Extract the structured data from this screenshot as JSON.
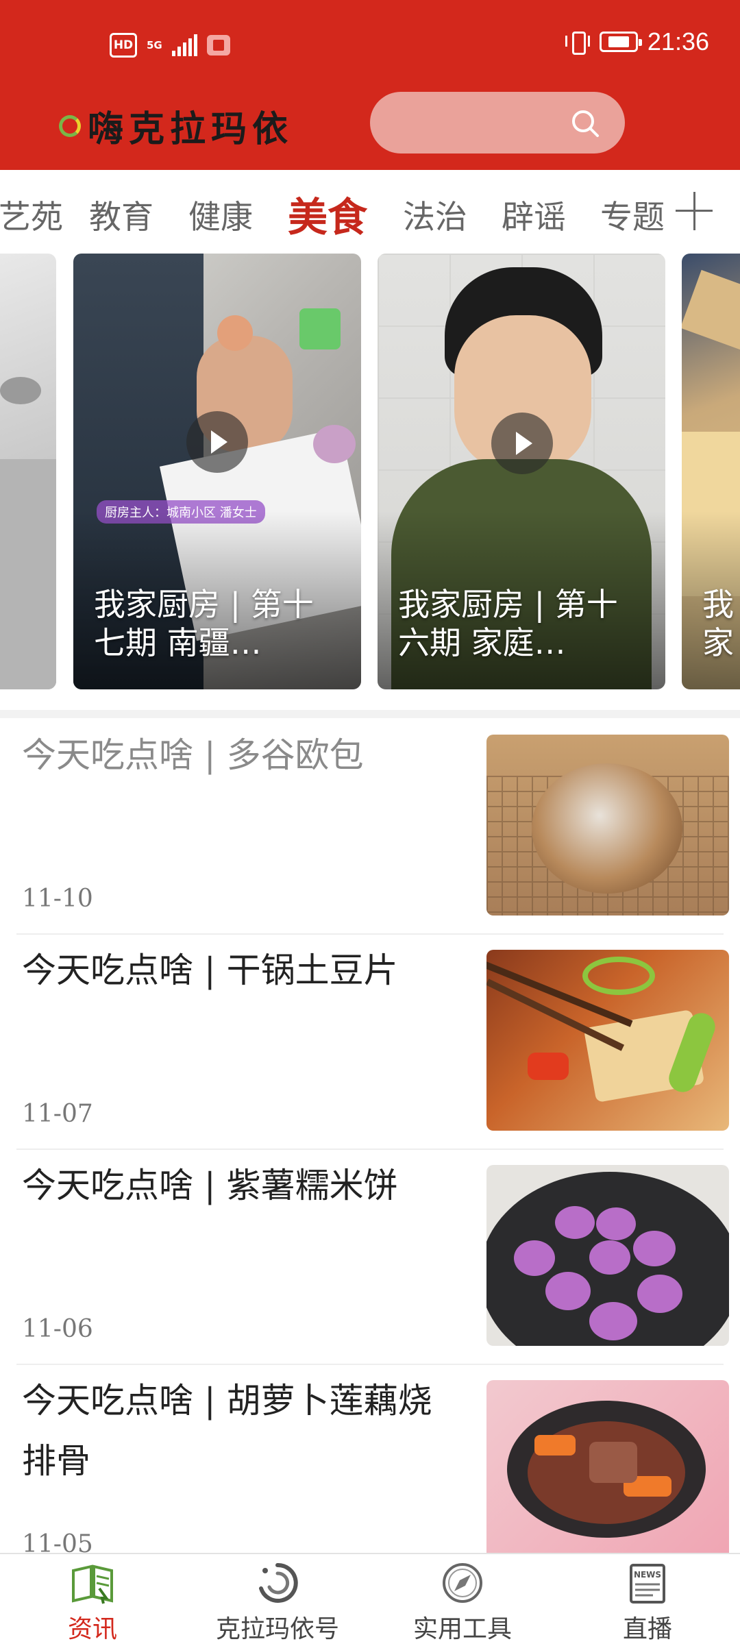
{
  "status_bar": {
    "hd_badge": "HD",
    "network": "5G",
    "time": "21:36"
  },
  "header": {
    "logo_text": "嗨克拉玛依",
    "search_placeholder": ""
  },
  "tabs": [
    {
      "label": "艺苑",
      "active": false
    },
    {
      "label": "教育",
      "active": false
    },
    {
      "label": "健康",
      "active": false
    },
    {
      "label": "美食",
      "active": true
    },
    {
      "label": "法治",
      "active": false
    },
    {
      "label": "辟谣",
      "active": false
    },
    {
      "label": "专题",
      "active": false
    }
  ],
  "videos": [
    {
      "title": "我家厨房 | 第十七期 南疆…",
      "tag": "厨房主人：城南小区 潘女士"
    },
    {
      "title": "我家厨房 | 第十六期 家庭…"
    },
    {
      "title": "我家厨房 | 第十…"
    }
  ],
  "articles": [
    {
      "title": "今天吃点啥 | 多谷欧包",
      "date": "11-10",
      "read": true
    },
    {
      "title": "今天吃点啥 | 干锅土豆片",
      "date": "11-07",
      "read": false
    },
    {
      "title": "今天吃点啥 | 紫薯糯米饼",
      "date": "11-06",
      "read": false
    },
    {
      "title": "今天吃点啥 | 胡萝卜莲藕烧排骨",
      "date": "11-05",
      "read": false
    }
  ],
  "bottom_nav": [
    {
      "label": "资讯",
      "icon": "news-book-icon",
      "active": true
    },
    {
      "label": "克拉玛依号",
      "icon": "swirl-icon",
      "active": false
    },
    {
      "label": "实用工具",
      "icon": "compass-icon",
      "active": false
    },
    {
      "label": "直播",
      "icon": "newspaper-icon",
      "active": false
    }
  ],
  "colors": {
    "brand_red": "#d3281c",
    "active_tab": "#c6281c",
    "search_fill": "#eaa29a"
  }
}
